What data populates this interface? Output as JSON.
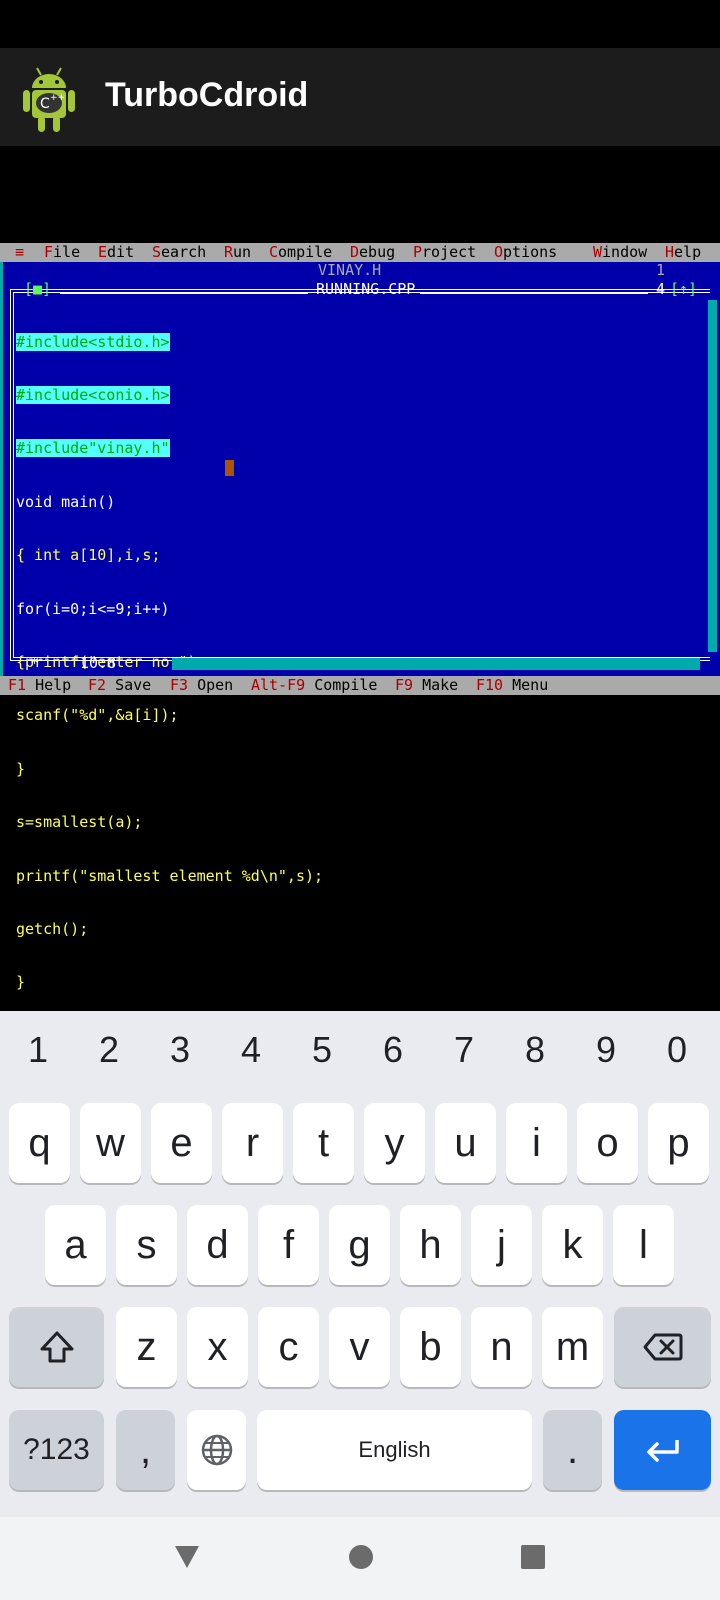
{
  "app": {
    "title": "TurboCdroid"
  },
  "ide": {
    "menu": [
      {
        "hot": "≡",
        "rest": ""
      },
      {
        "hot": "F",
        "rest": "ile"
      },
      {
        "hot": "E",
        "rest": "dit"
      },
      {
        "hot": "S",
        "rest": "earch"
      },
      {
        "hot": "R",
        "rest": "un"
      },
      {
        "hot": "C",
        "rest": "ompile"
      },
      {
        "hot": "D",
        "rest": "ebug"
      },
      {
        "hot": "P",
        "rest": "roject"
      },
      {
        "hot": "O",
        "rest": "ptions"
      },
      {
        "hot": "W",
        "rest": "indow"
      },
      {
        "hot": "H",
        "rest": "elp"
      }
    ],
    "bg_window_title": "VINAY.H",
    "bg_window_number": "1",
    "window_title": "RUNNING.CPP",
    "window_close": "[■]",
    "window_number": "4",
    "window_zoom": "[↑]",
    "cursor_position": "10:8",
    "code_lines": [
      "#include<stdio.h>",
      "#include<conio.h>",
      "#include\"vinay.h\"",
      "void main()",
      "{ int a[10],i,s;",
      "for(i=0;i<=9;i++)",
      "{printf(\"enter no \");",
      "scanf(\"%d\",&a[i]);",
      "}",
      "s=smallest(a);",
      "printf(\"smallest element %d\\n\",s);",
      "getch();",
      "}"
    ],
    "function_keys": [
      {
        "key": "F1",
        "label": "Help"
      },
      {
        "key": "F2",
        "label": "Save"
      },
      {
        "key": "F3",
        "label": "Open"
      },
      {
        "key": "Alt-F9",
        "label": "Compile"
      },
      {
        "key": "F9",
        "label": "Make"
      },
      {
        "key": "F10",
        "label": "Menu"
      }
    ]
  },
  "keyboard": {
    "numbers": [
      "1",
      "2",
      "3",
      "4",
      "5",
      "6",
      "7",
      "8",
      "9",
      "0"
    ],
    "row1": [
      "q",
      "w",
      "e",
      "r",
      "t",
      "y",
      "u",
      "i",
      "o",
      "p"
    ],
    "row2": [
      "a",
      "s",
      "d",
      "f",
      "g",
      "h",
      "j",
      "k",
      "l"
    ],
    "row3": [
      "z",
      "x",
      "c",
      "v",
      "b",
      "n",
      "m"
    ],
    "symbols_label": "?123",
    "comma": ",",
    "space_label": "English",
    "period": ".",
    "icons": [
      "shift-icon",
      "backspace-icon",
      "globe-icon",
      "enter-icon"
    ]
  },
  "nav": {
    "icons": [
      "back-icon",
      "home-icon",
      "recents-icon"
    ]
  }
}
